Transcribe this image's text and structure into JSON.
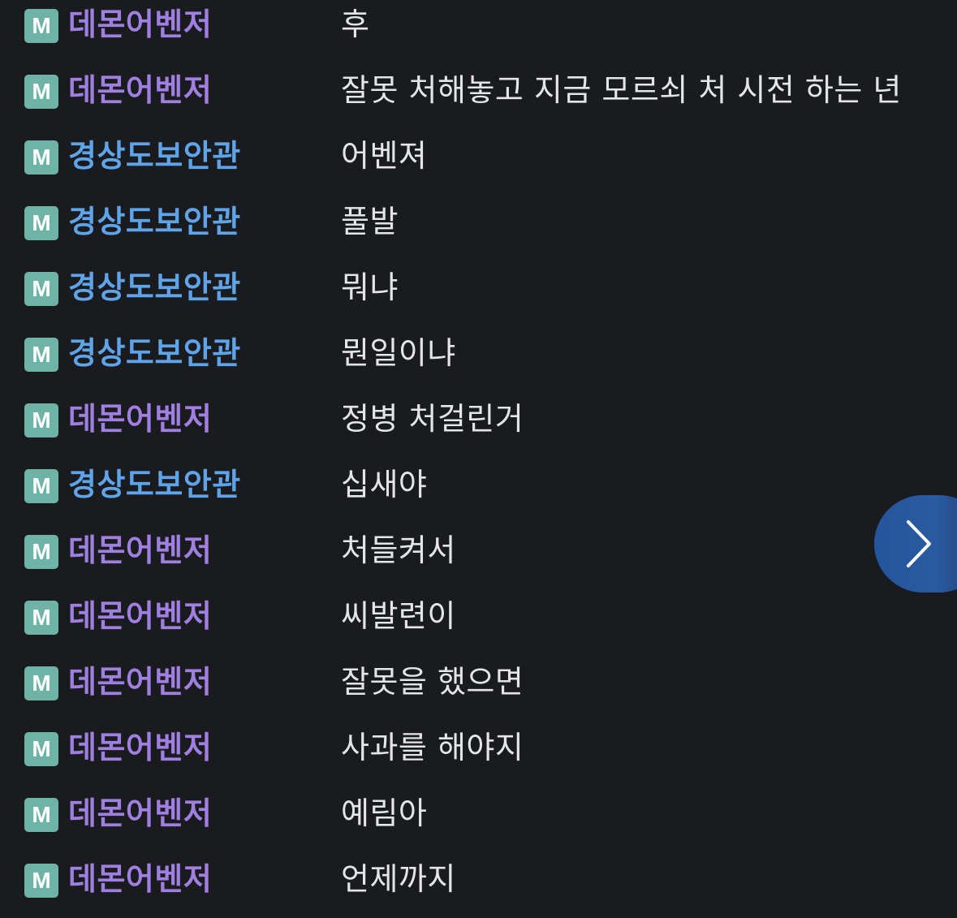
{
  "colors": {
    "background": "#1a1b1f",
    "badge": "#6fb3a7",
    "nick_demon": "#9f7fe0",
    "nick_gyeongsang": "#5fa3e8",
    "message": "#e4e5e8",
    "next_button": "#2a5aa0"
  },
  "badge_letter": "M",
  "chat": [
    {
      "nick": "데몬어벤저",
      "nick_color": "#9f7fe0",
      "msg": "후"
    },
    {
      "nick": "데몬어벤저",
      "nick_color": "#9f7fe0",
      "msg": "잘못 처해놓고 지금 모르쇠 처 시전 하는 년"
    },
    {
      "nick": "경상도보안관",
      "nick_color": "#5fa3e8",
      "msg": "어벤져"
    },
    {
      "nick": "경상도보안관",
      "nick_color": "#5fa3e8",
      "msg": "풀발"
    },
    {
      "nick": "경상도보안관",
      "nick_color": "#5fa3e8",
      "msg": "뭐냐"
    },
    {
      "nick": "경상도보안관",
      "nick_color": "#5fa3e8",
      "msg": "뭔일이냐"
    },
    {
      "nick": "데몬어벤저",
      "nick_color": "#9f7fe0",
      "msg": "정병 처걸린거"
    },
    {
      "nick": "경상도보안관",
      "nick_color": "#5fa3e8",
      "msg": "십새야"
    },
    {
      "nick": "데몬어벤저",
      "nick_color": "#9f7fe0",
      "msg": "처들켜서"
    },
    {
      "nick": "데몬어벤저",
      "nick_color": "#9f7fe0",
      "msg": "씨발련이"
    },
    {
      "nick": "데몬어벤저",
      "nick_color": "#9f7fe0",
      "msg": "잘못을 했으면"
    },
    {
      "nick": "데몬어벤저",
      "nick_color": "#9f7fe0",
      "msg": "사과를 해야지"
    },
    {
      "nick": "데몬어벤저",
      "nick_color": "#9f7fe0",
      "msg": "예림아"
    },
    {
      "nick": "데몬어벤저",
      "nick_color": "#9f7fe0",
      "msg": "언제까지"
    }
  ],
  "next_button_icon": "chevron-right-icon"
}
